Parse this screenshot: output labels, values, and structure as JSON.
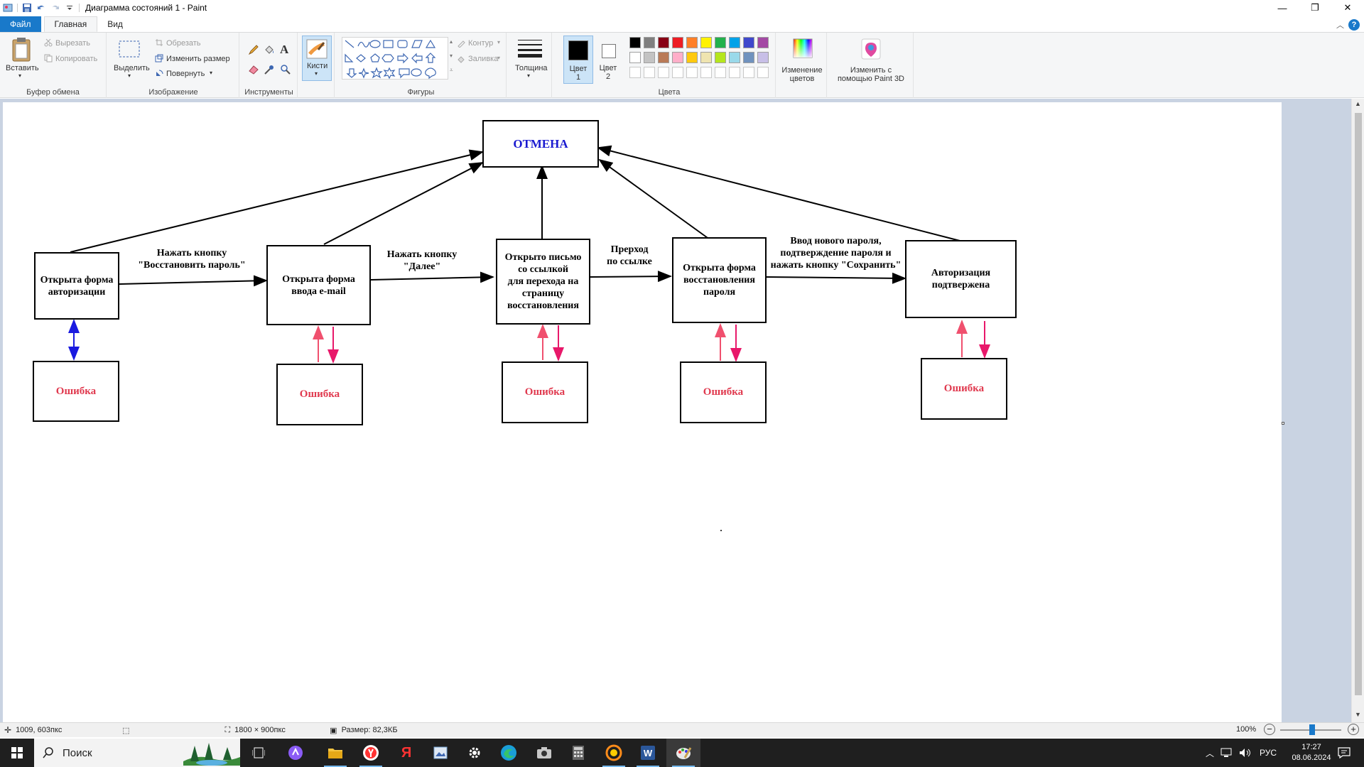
{
  "window": {
    "title": "Диаграмма состояний 1 - Paint",
    "controls": [
      "—",
      "❐",
      "✕"
    ]
  },
  "tabs": [
    {
      "label": "Файл"
    },
    {
      "label": "Главная"
    },
    {
      "label": "Вид"
    }
  ],
  "ribbon": {
    "clipboard": {
      "group": "Буфер обмена",
      "paste": "Вставить",
      "cut": "Вырезать",
      "copy": "Копировать"
    },
    "image": {
      "group": "Изображение",
      "select": "Выделить",
      "crop": "Обрезать",
      "resize": "Изменить размер",
      "rotate": "Повернуть"
    },
    "tools": {
      "group": "Инструменты"
    },
    "brushes": {
      "label": "Кисти"
    },
    "shapes": {
      "group": "Фигуры",
      "outline": "Контур",
      "fill": "Заливка"
    },
    "size": {
      "label": "Толщина"
    },
    "color1": {
      "label": "Цвет 1",
      "label_line1": "Цвет",
      "label_line2": "1",
      "value": "#000000"
    },
    "color2": {
      "label": "Цвет 2",
      "label_line1": "Цвет",
      "label_line2": "2",
      "value": "#ffffff"
    },
    "colors": {
      "group": "Цвета",
      "row1": [
        "#000000",
        "#7f7f7f",
        "#880015",
        "#ed1c24",
        "#ff7f27",
        "#fff200",
        "#22b14c",
        "#00a2e8",
        "#3f48cc",
        "#a349a4"
      ],
      "row2": [
        "#ffffff",
        "#c3c3c3",
        "#b97a57",
        "#ffaec9",
        "#ffc90e",
        "#efe4b0",
        "#b5e61d",
        "#99d9ea",
        "#7092be",
        "#c8bfe7"
      ],
      "row3": [
        "#ffffff",
        "#ffffff",
        "#ffffff",
        "#ffffff",
        "#ffffff",
        "#ffffff",
        "#ffffff",
        "#ffffff",
        "#ffffff",
        "#ffffff"
      ]
    },
    "edit_colors": {
      "line1": "Изменение",
      "line2": "цветов"
    },
    "paint3d": {
      "line1": "Изменить с",
      "line2": "помощью Paint 3D"
    }
  },
  "diagram": {
    "cancel": "ОТМЕНА",
    "states": [
      {
        "text": "Открыта форма\nавторизации"
      },
      {
        "text": "Открыта форма\nввода e-mail"
      },
      {
        "text": "Открыто письмо\nсо ссылкой\nдля перехода на\nстраницу\nвосстановления"
      },
      {
        "text": "Открыта форма\nвосстановления\nпароля"
      },
      {
        "text": "Авторизация\nподтвержена"
      }
    ],
    "errors": [
      "Ошибка",
      "Ошибка",
      "Ошибка",
      "Ошибка",
      "Ошибка"
    ],
    "transitions": [
      {
        "text": "Нажать кнопку\n\"Восстановить пароль\""
      },
      {
        "text": "Нажать кнопку\n\"Далее\""
      },
      {
        "text": "Прерход\nпо ссылке"
      },
      {
        "text": "Ввод нового пароля,\nподтверждение пароля и\nнажать кнопку \"Сохранить\""
      }
    ]
  },
  "status": {
    "cursor_pos": "1009, 603пкс",
    "image_size": "1800 × 900пкс",
    "file_size": "Размер: 82,3КБ",
    "zoom": "100%"
  },
  "taskbar": {
    "search": "Поиск",
    "lang": "РУС",
    "time": "17:27",
    "date": "08.06.2024"
  }
}
